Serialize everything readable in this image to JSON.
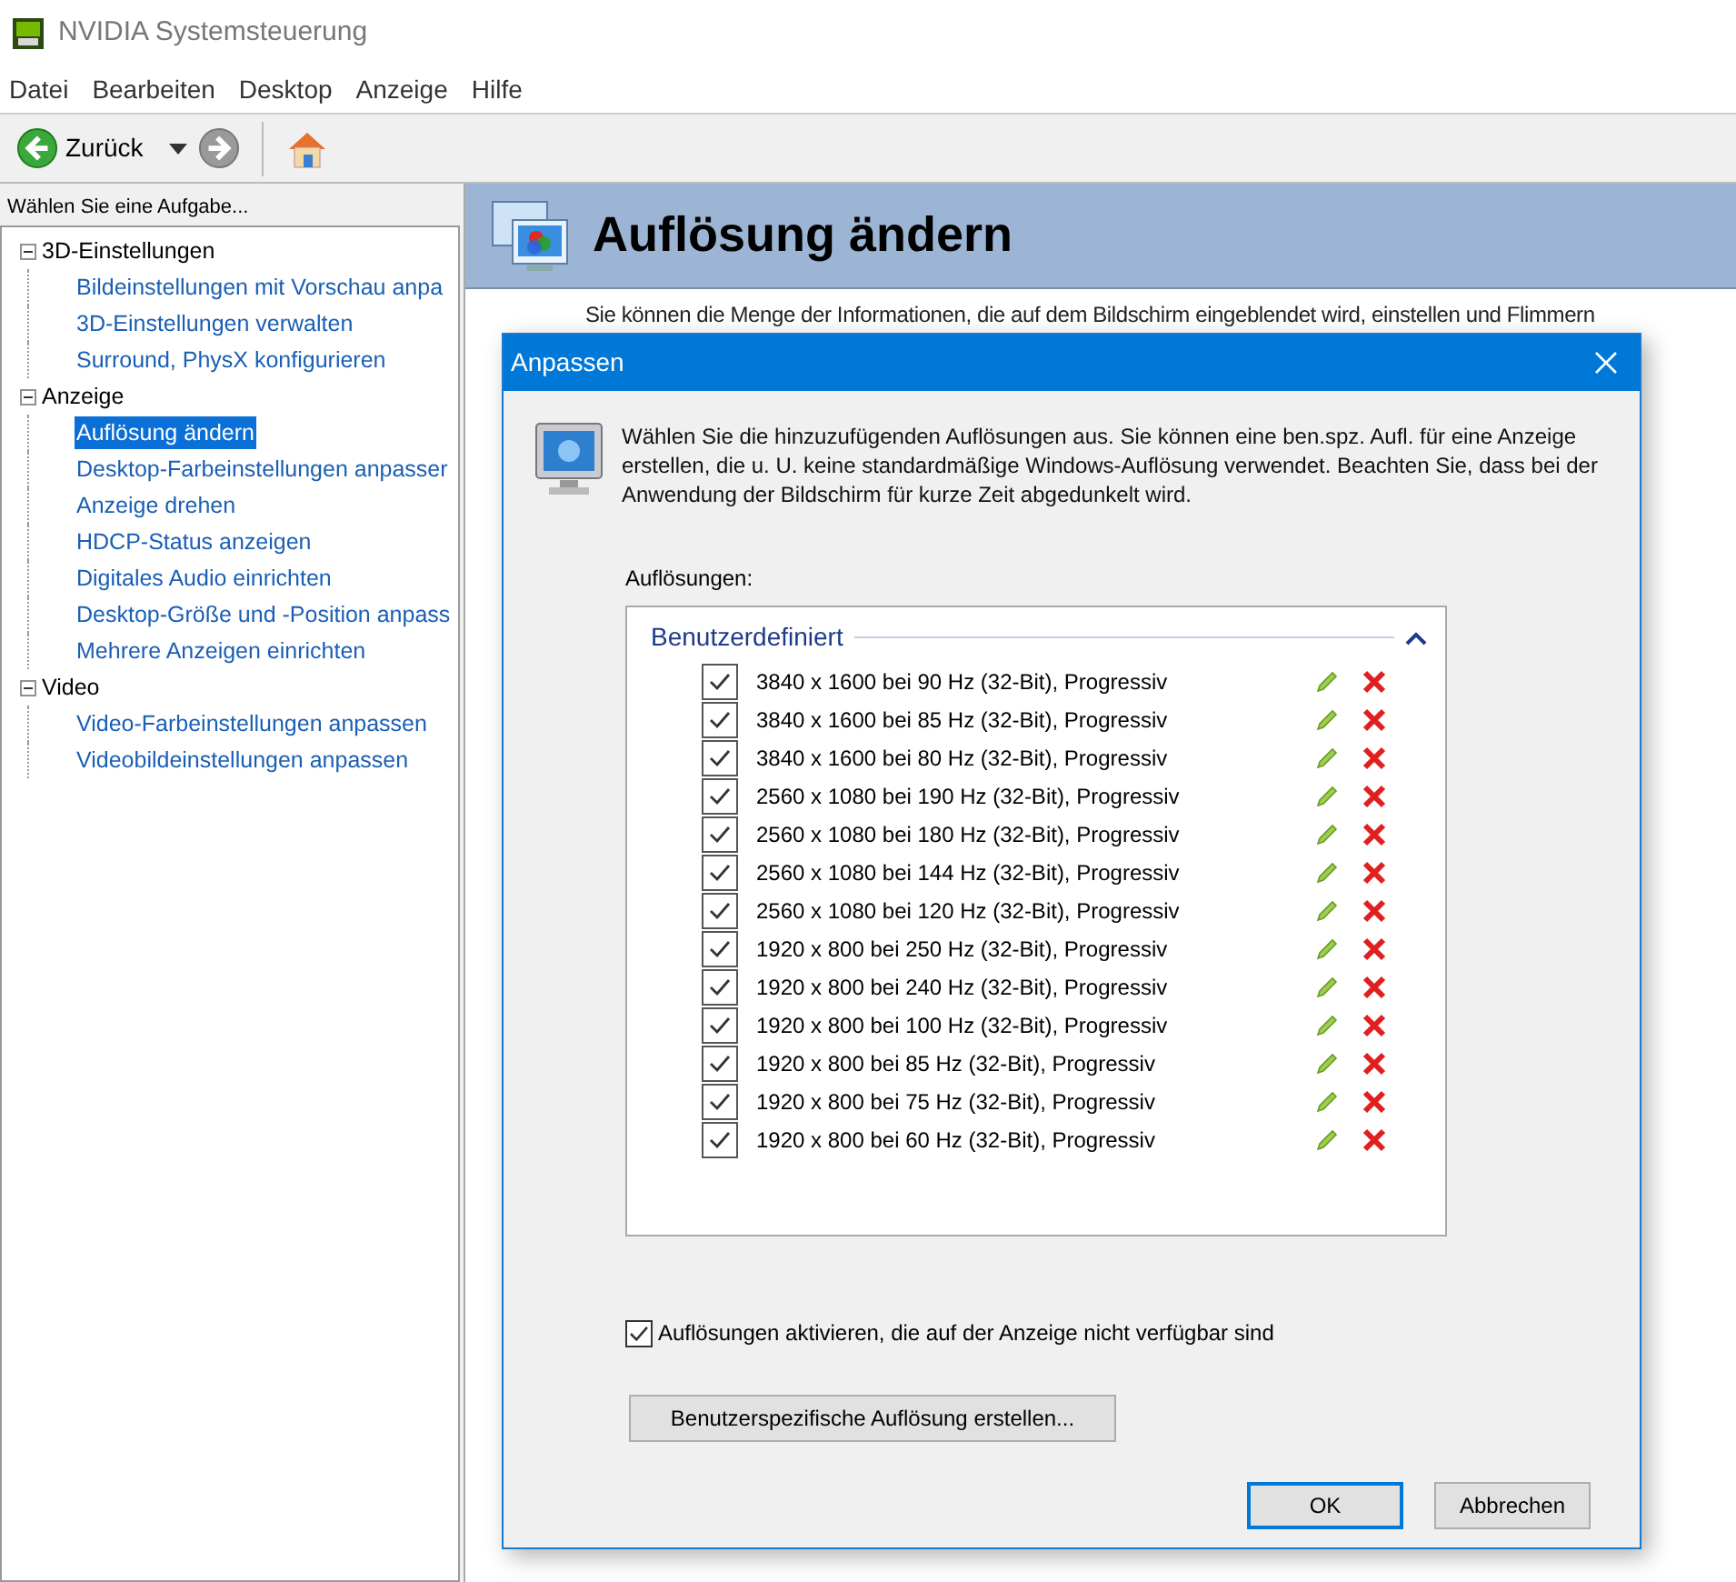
{
  "window": {
    "title": "NVIDIA Systemsteuerung"
  },
  "menu": [
    "Datei",
    "Bearbeiten",
    "Desktop",
    "Anzeige",
    "Hilfe"
  ],
  "toolbar": {
    "back_label": "Zurück"
  },
  "sidebar": {
    "header": "Wählen Sie eine Aufgabe...",
    "tree": [
      {
        "label": "3D-Einstellungen",
        "expanded": true,
        "children": [
          {
            "label": "Bildeinstellungen mit Vorschau anpa",
            "selected": false
          },
          {
            "label": "3D-Einstellungen verwalten",
            "selected": false
          },
          {
            "label": "Surround, PhysX konfigurieren",
            "selected": false
          }
        ]
      },
      {
        "label": "Anzeige",
        "expanded": true,
        "children": [
          {
            "label": "Auflösung ändern",
            "selected": true
          },
          {
            "label": "Desktop-Farbeinstellungen anpasser",
            "selected": false
          },
          {
            "label": "Anzeige drehen",
            "selected": false
          },
          {
            "label": "HDCP-Status anzeigen",
            "selected": false
          },
          {
            "label": "Digitales Audio einrichten",
            "selected": false
          },
          {
            "label": "Desktop-Größe und -Position anpass",
            "selected": false
          },
          {
            "label": "Mehrere Anzeigen einrichten",
            "selected": false
          }
        ]
      },
      {
        "label": "Video",
        "expanded": true,
        "children": [
          {
            "label": "Video-Farbeinstellungen anpassen",
            "selected": false
          },
          {
            "label": "Videobildeinstellungen anpassen",
            "selected": false
          }
        ]
      }
    ]
  },
  "page": {
    "title": "Auflösung ändern",
    "intro": "Sie können die Menge der Informationen, die auf dem Bildschirm eingeblendet wird, einstellen und Flimmern"
  },
  "dialog": {
    "title": "Anpassen",
    "description": "Wählen Sie die hinzuzufügenden Auflösungen aus. Sie können eine ben.spz. Aufl. für eine Anzeige erstellen, die u. U. keine standardmäßige Windows-Auflösung verwendet. Beachten Sie, dass bei der Anwendung der Bildschirm für kurze Zeit abgedunkelt wird.",
    "list_label": "Auflösungen:",
    "group": {
      "title": "Benutzerdefiniert",
      "expanded": true
    },
    "resolutions": [
      {
        "label": "3840 x 1600 bei 90 Hz (32-Bit), Progressiv",
        "checked": true
      },
      {
        "label": "3840 x 1600 bei 85 Hz (32-Bit), Progressiv",
        "checked": true
      },
      {
        "label": "3840 x 1600 bei 80 Hz (32-Bit), Progressiv",
        "checked": true
      },
      {
        "label": "2560 x 1080 bei 190 Hz (32-Bit), Progressiv",
        "checked": true
      },
      {
        "label": "2560 x 1080 bei 180 Hz (32-Bit), Progressiv",
        "checked": true
      },
      {
        "label": "2560 x 1080 bei 144 Hz (32-Bit), Progressiv",
        "checked": true
      },
      {
        "label": "2560 x 1080 bei 120 Hz (32-Bit), Progressiv",
        "checked": true
      },
      {
        "label": "1920 x 800 bei 250 Hz (32-Bit), Progressiv",
        "checked": true
      },
      {
        "label": "1920 x 800 bei 240 Hz (32-Bit), Progressiv",
        "checked": true
      },
      {
        "label": "1920 x 800 bei 100 Hz (32-Bit), Progressiv",
        "checked": true
      },
      {
        "label": "1920 x 800 bei 85 Hz (32-Bit), Progressiv",
        "checked": true
      },
      {
        "label": "1920 x 800 bei 75 Hz (32-Bit), Progressiv",
        "checked": true
      },
      {
        "label": "1920 x 800 bei 60 Hz (32-Bit), Progressiv",
        "checked": true
      }
    ],
    "enable_unavailable": {
      "label": "Auflösungen aktivieren, die auf der Anzeige nicht verfügbar sind",
      "checked": true
    },
    "custom_button": "Benutzerspezifische Auflösung erstellen...",
    "buttons": [
      {
        "label": "OK",
        "default": true
      },
      {
        "label": "Abbrechen",
        "default": false
      }
    ]
  }
}
